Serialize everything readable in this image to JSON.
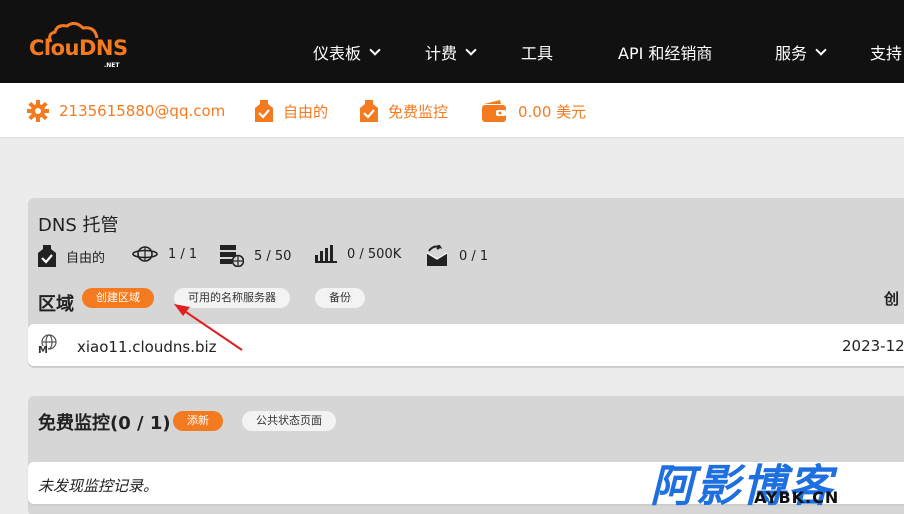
{
  "header": {
    "logo_text": "ClouDNS",
    "logo_suffix": ".NET",
    "nav": [
      {
        "label": "仪表板",
        "has_dropdown": true
      },
      {
        "label": "计费",
        "has_dropdown": true
      },
      {
        "label": "工具",
        "has_dropdown": false
      },
      {
        "label": "API 和经销商",
        "has_dropdown": false
      },
      {
        "label": "服务",
        "has_dropdown": true
      },
      {
        "label": "支持",
        "has_dropdown": false
      }
    ]
  },
  "account_bar": {
    "email": "2135615880@qq.com",
    "plan": "自由的",
    "monitoring": "免费监控",
    "balance": "0.00 美元"
  },
  "dns_card": {
    "title": "DNS 托管",
    "stats": {
      "plan": "自由的",
      "zones": "1 / 1",
      "records": "5 / 50",
      "queries": "0 / 500K",
      "mail_forwards": "0 / 1"
    },
    "zones_heading": "区域",
    "buttons": {
      "create_zone": "创建区域",
      "nameservers": "可用的名称服务器",
      "backup": "备份"
    },
    "right_label": "创",
    "zone_rows": [
      {
        "name": "xiao11.cloudns.biz",
        "date": "2023-12",
        "icon_letter": "M"
      }
    ]
  },
  "monitor_card": {
    "title": "免费监控(0 / 1)",
    "buttons": {
      "add": "添新",
      "status_page": "公共状态页面"
    },
    "empty_message": "未发现监控记录。"
  },
  "watermark": {
    "main": "阿影博客",
    "sub": "AYBK.CN"
  },
  "colors": {
    "accent": "#f47a20",
    "nav_bg": "#111111",
    "card_bg": "#d6d6d6",
    "watermark": "#1e6fe0"
  }
}
